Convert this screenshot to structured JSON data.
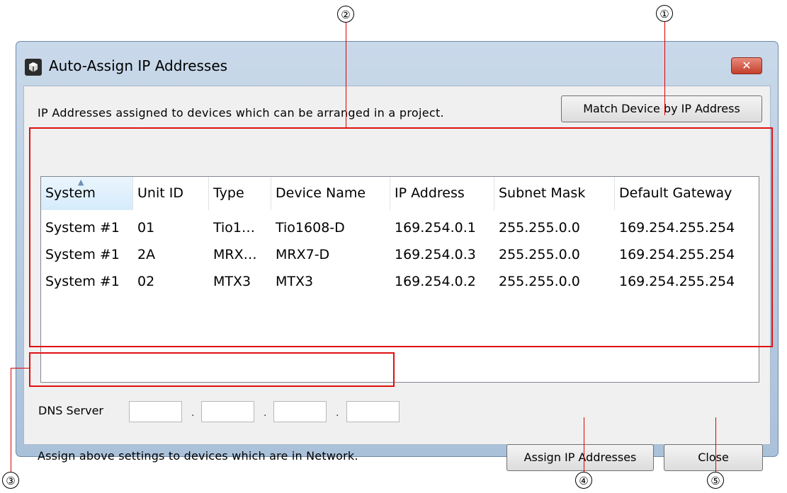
{
  "window": {
    "title": "Auto-Assign IP Addresses",
    "close_glyph": "✕",
    "icon": "app-logo-icon"
  },
  "intro_text": "IP Addresses assigned to devices which can be arranged in a project.",
  "match_button_label": "Match Device by IP Address",
  "table": {
    "columns": [
      "System",
      "Unit ID",
      "Type",
      "Device Name",
      "IP Address",
      "Subnet Mask",
      "Default Gateway"
    ],
    "sort_glyph": "▲",
    "rows": [
      [
        "System #1",
        "01",
        "Tio1…",
        "Tio1608-D",
        "169.254.0.1",
        "255.255.0.0",
        "169.254.255.254"
      ],
      [
        "System #1",
        "2A",
        "MRX…",
        "MRX7-D",
        "169.254.0.3",
        "255.255.0.0",
        "169.254.255.254"
      ],
      [
        "System #1",
        "02",
        "MTX3",
        "MTX3",
        "169.254.0.2",
        "255.255.0.0",
        "169.254.255.254"
      ]
    ]
  },
  "dns": {
    "label": "DNS Server",
    "octets": [
      "",
      "",
      "",
      ""
    ],
    "separator": "."
  },
  "assign_text": "Assign above settings to devices which are in Network.",
  "assign_button_label": "Assign IP Addresses",
  "close_button_label": "Close",
  "callouts": [
    "①",
    "②",
    "③",
    "④",
    "⑤"
  ],
  "colors": {
    "callout_red": "#e01010",
    "title_gradient_top": "#c9d9ea",
    "close_red": "#c43f2b",
    "sorted_header": "#d6ecfb"
  }
}
